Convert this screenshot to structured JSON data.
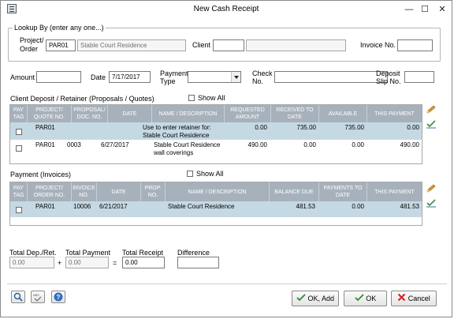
{
  "window": {
    "title": "New Cash Receipt",
    "minimize_glyph": "—",
    "maximize_glyph": "☐",
    "close_glyph": "✕"
  },
  "lookup": {
    "group_label": "Lookup By (enter any one...)",
    "project_label_line1": "Project/",
    "project_label_line2": "Order",
    "project_value": "PAR01",
    "project_name": "Stable Court Residence",
    "client_label": "Client",
    "client_value": "",
    "client_name": "",
    "invoice_label": "Invoice No.",
    "invoice_value": ""
  },
  "details": {
    "amount_label": "Amount",
    "amount_value": "",
    "date_label": "Date",
    "date_value": "7/17/2017",
    "payment_type_label_line1": "Payment",
    "payment_type_label_line2": "Type",
    "payment_type_value": "",
    "check_label_line1": "Check",
    "check_label_line2": "No.",
    "check_value": "",
    "deposit_label_line1": "Deposit",
    "deposit_label_line2": "Slip No.",
    "deposit_value": ""
  },
  "retainer": {
    "section_label": "Client Deposit / Retainer (Proposals / Quotes)",
    "show_all_label": "Show All",
    "columns": [
      "PAY\nTAG",
      "PROJECT/\nQUOTE NO.",
      "PROPOSAL/\nDOC. NO.",
      "DATE",
      "NAME / DESCRIPTION",
      "REQUESTED\nAMOUNT",
      "RECEIVED TO\nDATE",
      "AVAILABLE",
      "THIS PAYMENT"
    ],
    "rows": [
      {
        "project": "PAR01",
        "doc": "",
        "date": "",
        "desc1": "Use to enter retainer for:",
        "desc2": "Stable Court Residence",
        "requested": "0.00",
        "received": "735.00",
        "available": "735.00",
        "payment": "0.00"
      },
      {
        "project": "PAR01",
        "doc": "0003",
        "date": "6/27/2017",
        "desc1": "Stable Court Residence",
        "desc2": "wall coverings",
        "requested": "490.00",
        "received": "0.00",
        "available": "0.00",
        "payment": "490.00"
      }
    ]
  },
  "invoices": {
    "section_label": "Payment (Invoices)",
    "show_all_label": "Show All",
    "columns": [
      "PAY\nTAG",
      "PROJECT/\nORDER NO.",
      "INVOICE\nNO.",
      "DATE",
      "PROP.\nNO.",
      "NAME / DESCRIPTION",
      "BALANCE DUE",
      "PAYMENTS TO\nDATE",
      "THIS PAYMENT"
    ],
    "rows": [
      {
        "project": "PAR01",
        "invoice": "10006",
        "date": "6/21/2017",
        "prop": "",
        "desc": "Stable Court Residence",
        "balance": "481.53",
        "paid": "0.00",
        "payment": "481.53"
      }
    ]
  },
  "totals": {
    "dep_label": "Total Dep./Ret.",
    "dep_value": "0.00",
    "plus": "+",
    "payment_label": "Total Payment",
    "payment_value": "0.00",
    "equals": "=",
    "receipt_label": "Total Receipt",
    "receipt_value": "0.00",
    "diff_label": "Difference",
    "diff_value": ""
  },
  "buttons": {
    "ok_add": "OK, Add",
    "ok": "OK",
    "cancel": "Cancel",
    "spell_glyph": "ABC"
  },
  "colors": {
    "grid_header": "#a7b1bb",
    "selected_row": "#c5d9e4"
  }
}
